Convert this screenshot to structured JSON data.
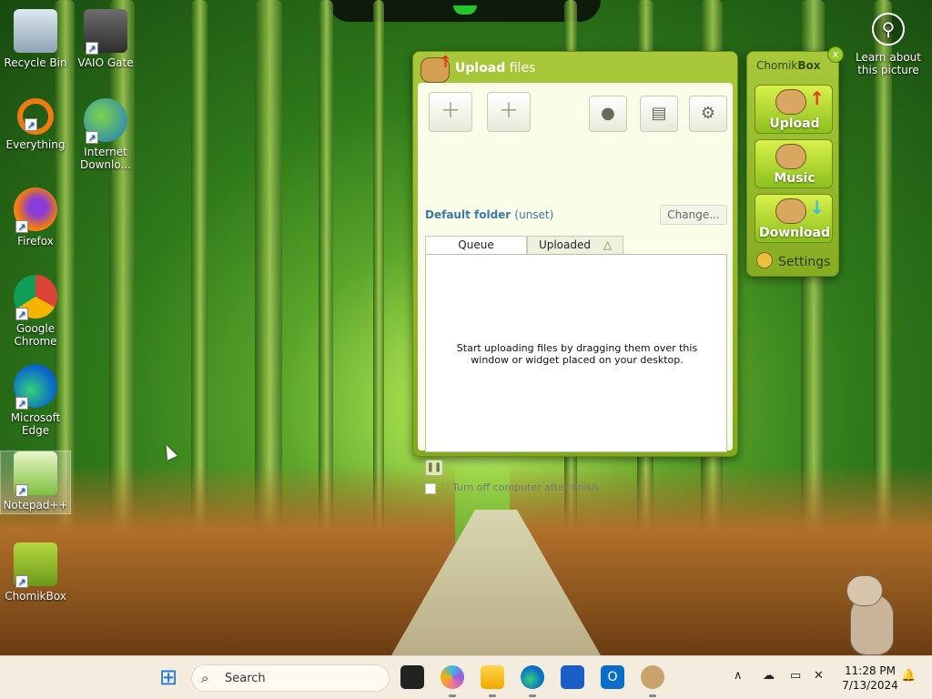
{
  "desktop": {
    "icons": [
      {
        "label": "Recycle Bin",
        "icon": "recycle-bin-icon"
      },
      {
        "label": "VAIO Gate",
        "icon": "vaio-gate-icon"
      },
      {
        "label": "Everything",
        "icon": "everything-search-icon"
      },
      {
        "label": "Internet Downlo...",
        "icon": "internet-download-manager-icon"
      },
      {
        "label": "Firefox",
        "icon": "firefox-icon"
      },
      {
        "label": "Google Chrome",
        "icon": "chrome-icon"
      },
      {
        "label": "Microsoft Edge",
        "icon": "edge-icon"
      },
      {
        "label": "Notepad++",
        "icon": "notepad-plus-plus-icon"
      },
      {
        "label": "ChomikBox",
        "icon": "chomikbox-icon"
      }
    ],
    "learn_about": "Learn about this picture"
  },
  "upload_window": {
    "title_bold": "Upload",
    "title_rest": " files",
    "default_folder_label": "Default folder",
    "default_folder_value": "(unset)",
    "change_button": "Change...",
    "tabs": [
      {
        "label": "Queue",
        "active": true
      },
      {
        "label": "Uploaded",
        "active": false,
        "indicator": "△"
      }
    ],
    "empty_message": "Start uploading files by dragging them over this window or widget placed on your desktop.",
    "shutdown_option": "Turn off computer after finish"
  },
  "widget": {
    "title_prefix": "Chomik",
    "title_bold": "Box",
    "close": "x",
    "buttons": [
      {
        "label": "Upload",
        "arrow_color": "#e8381a"
      },
      {
        "label": "Music",
        "arrow_color": ""
      },
      {
        "label": "Download",
        "arrow_color": "#3ab8e8"
      }
    ],
    "settings": "Settings"
  },
  "taskbar": {
    "search_placeholder": "Search",
    "clock_time": "11:28 PM",
    "clock_date": "7/13/2024"
  },
  "colors": {
    "accent_green": "#a8c83a",
    "panel_bg": "#fafde8",
    "link_blue": "#3b7aa5"
  }
}
